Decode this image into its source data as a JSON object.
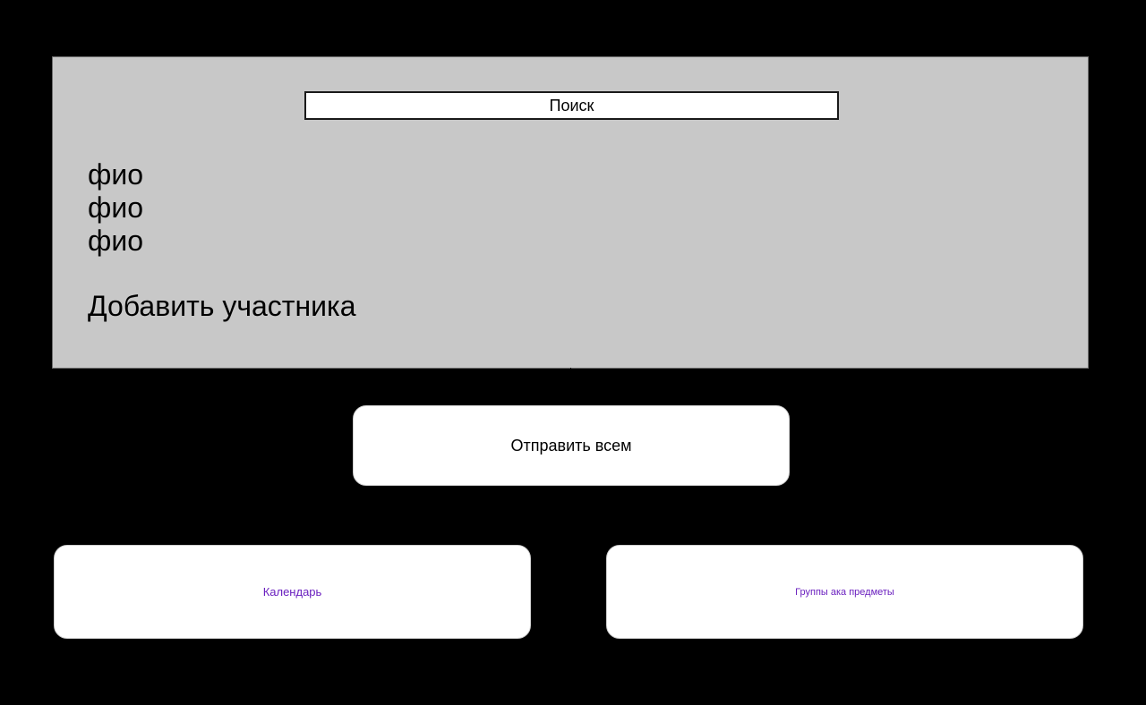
{
  "members_panel": {
    "search": {
      "placeholder": "Поиск",
      "value": ""
    },
    "members": [
      {
        "name": "фио"
      },
      {
        "name": "фио"
      },
      {
        "name": "фио"
      }
    ],
    "add_member_label": "Добавить участника"
  },
  "actions": {
    "send_all_label": "Отправить всем",
    "calendar_label": "Календарь",
    "groups_label": "Группы ака предметы"
  },
  "colors": {
    "background": "#000000",
    "panel": "#c8c8c8",
    "button": "#ffffff",
    "link_text": "#6a1fbf"
  }
}
